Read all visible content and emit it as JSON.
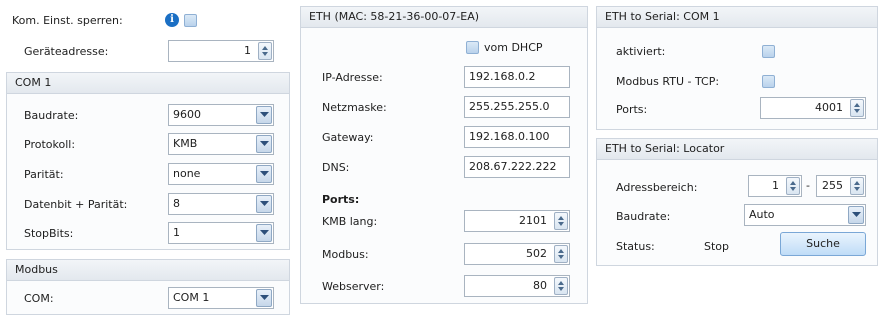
{
  "top": {
    "lock_label": "Kom. Einst. sperren:",
    "device_address_label": "Geräteadresse:",
    "device_address_value": "1"
  },
  "com1": {
    "title": "COM 1",
    "baudrate_label": "Baudrate:",
    "baudrate_value": "9600",
    "protocol_label": "Protokoll:",
    "protocol_value": "KMB",
    "parity_label": "Parität:",
    "parity_value": "none",
    "databits_label": "Datenbit + Parität:",
    "databits_value": "8",
    "stopbits_label": "StopBits:",
    "stopbits_value": "1"
  },
  "modbus": {
    "title": "Modbus",
    "com_label": "COM:",
    "com_value": "COM 1"
  },
  "eth": {
    "title": "ETH (MAC: 58-21-36-00-07-EA)",
    "dhcp_label": "vom DHCP",
    "ip_label": "IP-Adresse:",
    "ip_value": "192.168.0.2",
    "netmask_label": "Netzmaske:",
    "netmask_value": "255.255.255.0",
    "gateway_label": "Gateway:",
    "gateway_value": "192.168.0.100",
    "dns_label": "DNS:",
    "dns_value": "208.67.222.222",
    "ports_heading": "Ports:",
    "kmb_label": "KMB lang:",
    "kmb_value": "2101",
    "modbus_label": "Modbus:",
    "modbus_value": "502",
    "web_label": "Webserver:",
    "web_value": "80"
  },
  "serial": {
    "title": "ETH to Serial: COM 1",
    "enabled_label": "aktiviert:",
    "rtu_label": "Modbus RTU - TCP:",
    "ports_label": "Ports:",
    "ports_value": "4001"
  },
  "locator": {
    "title": "ETH to Serial: Locator",
    "range_label": "Adressbereich:",
    "range_from": "1",
    "range_sep": "-",
    "range_to": "255",
    "baud_label": "Baudrate:",
    "baud_value": "Auto",
    "status_label": "Status:",
    "status_value": "Stop",
    "search_label": "Suche"
  },
  "icons": {
    "info": "info-icon",
    "spin": "spinner-arrows-icon",
    "dropdown": "chevron-down-icon",
    "checkbox": "checkbox-unchecked-icon"
  },
  "colors": {
    "accent": "#1b6fc4",
    "panel_border": "#cfd6df",
    "button": "#bfdcf7"
  }
}
